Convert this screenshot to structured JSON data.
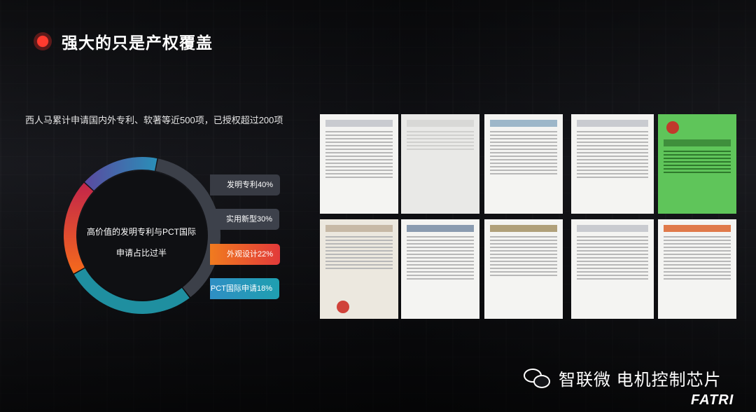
{
  "title": "强大的只是产权覆盖",
  "subtitle": "西人马累计申请国内外专利、软著等近500项，已授权超过200项",
  "center_text": {
    "line1": "高价值的发明专利与PCT国际",
    "line2": "申请占比过半"
  },
  "chart_data": {
    "type": "pie",
    "categories": [
      "发明专利",
      "实用新型",
      "外观设计",
      "PCT国际申请"
    ],
    "values": [
      40,
      30,
      22,
      18
    ],
    "labels": [
      "发明专利40%",
      "实用新型30%",
      "外观设计22%",
      "PCT国际申请18%"
    ],
    "colors": [
      "#3c4049",
      "#1f8fa0",
      "#e24a3a",
      "#6a5aa8"
    ]
  },
  "footer": {
    "brand": "智联微 电机控制芯片",
    "logo": "FATRI",
    "icon": "wechat-icon"
  }
}
